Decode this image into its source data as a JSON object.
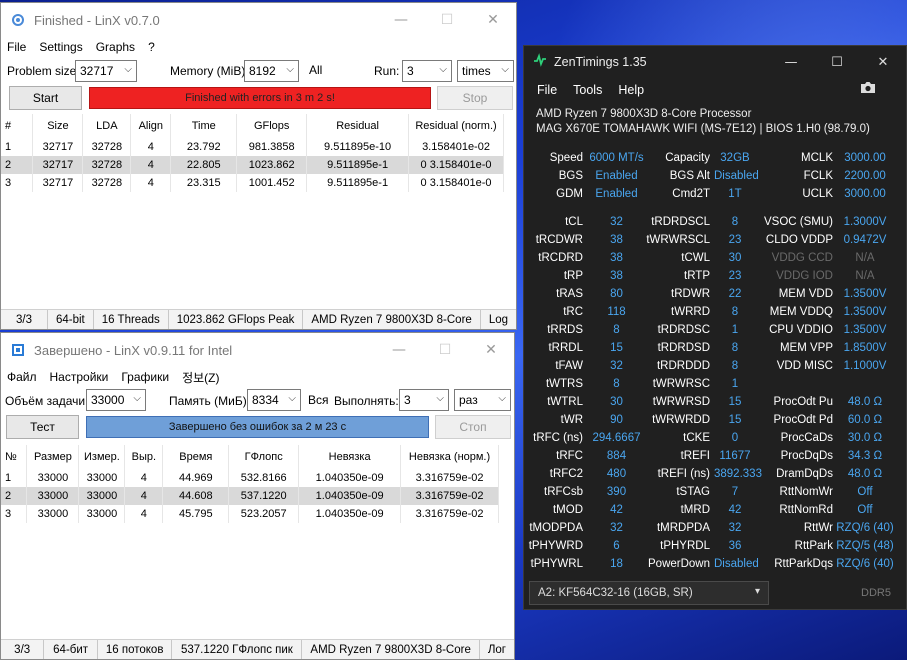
{
  "win1": {
    "title": "Finished - LinX v0.7.0",
    "menu": [
      "File",
      "Settings",
      "Graphs",
      "?"
    ],
    "problem_label": "Problem size:",
    "problem_value": "32717",
    "memory_label": "Memory (MiB):",
    "memory_value": "8192",
    "all_label": "All",
    "run_label": "Run:",
    "run_value": "3",
    "times_value": "times",
    "start": "Start",
    "stop": "Stop",
    "progress": "Finished with errors in 3 m 2 s!",
    "headers": [
      "#",
      "Size",
      "LDA",
      "Align",
      "Time",
      "GFlops",
      "Residual",
      "Residual (norm.)"
    ],
    "rows": [
      [
        "1",
        "32717",
        "32728",
        "4",
        "23.792",
        "981.3858",
        "9.511895e-10",
        "3.158401e-02"
      ],
      [
        "2",
        "32717",
        "32728",
        "4",
        "22.805",
        "1023.862",
        "9.511895e-1",
        "0 3.158401e-0"
      ],
      [
        "3",
        "32717",
        "32728",
        "4",
        "23.315",
        "1001.452",
        "9.511895e-1",
        "0 3.158401e-0"
      ]
    ],
    "status": [
      "3/3",
      "64-bit",
      "16 Threads",
      "1023.862 GFlops Peak",
      "AMD Ryzen 7 9800X3D 8-Core",
      "Log"
    ]
  },
  "win2": {
    "title": "Завершено - LinX v0.9.11 for Intel",
    "menu": [
      "Файл",
      "Настройки",
      "Графики",
      "정보(Z)"
    ],
    "problem_label": "Объём задачи:",
    "problem_value": "33000",
    "memory_label": "Память (МиБ):",
    "memory_value": "8334",
    "all_label": "Вся",
    "run_label": "Выполнять:",
    "run_value": "3",
    "times_value": "раз",
    "start": "Тест",
    "stop": "Стоп",
    "progress": "Завершено без ошибок за 2 м 23 с",
    "headers": [
      "№",
      "Размер",
      "Измер.",
      "Выр.",
      "Время",
      "ГФлопс",
      "Невязка",
      "Невязка (норм.)"
    ],
    "rows": [
      [
        "1",
        "33000",
        "33000",
        "4",
        "44.969",
        "532.8166",
        "1.040350e-09",
        "3.316759e-02"
      ],
      [
        "2",
        "33000",
        "33000",
        "4",
        "44.608",
        "537.1220",
        "1.040350e-09",
        "3.316759e-02"
      ],
      [
        "3",
        "33000",
        "33000",
        "4",
        "45.795",
        "523.2057",
        "1.040350e-09",
        "3.316759e-02"
      ]
    ],
    "status": [
      "3/3",
      "64-бит",
      "16 потоков",
      "537.1220 ГФлопс пик",
      "AMD Ryzen 7 9800X3D 8-Core",
      "Лог"
    ]
  },
  "zen": {
    "title": "ZenTimings 1.35",
    "menu": [
      "File",
      "Tools",
      "Help"
    ],
    "cpu": "AMD Ryzen 7 9800X3D 8-Core Processor",
    "board": "MAG X670E TOMAHAWK WIFI (MS-7E12) | BIOS 1.H0 (98.79.0)",
    "top": [
      [
        "Speed",
        "6000 MT/s",
        "Capacity",
        "32GB",
        "MCLK",
        "3000.00"
      ],
      [
        "BGS",
        "Enabled",
        "BGS Alt",
        "Disabled",
        "FCLK",
        "2200.00"
      ],
      [
        "GDM",
        "Enabled",
        "Cmd2T",
        "1T",
        "UCLK",
        "3000.00"
      ]
    ],
    "timings": [
      [
        "tCL",
        "32",
        "tRDRDSCL",
        "8",
        "VSOC (SMU)",
        "1.3000V"
      ],
      [
        "tRCDWR",
        "38",
        "tWRWRSCL",
        "23",
        "CLDO VDDP",
        "0.9472V"
      ],
      [
        "tRCDRD",
        "38",
        "tCWL",
        "30",
        "VDDG CCD",
        "N/A"
      ],
      [
        "tRP",
        "38",
        "tRTP",
        "23",
        "VDDG IOD",
        "N/A"
      ],
      [
        "tRAS",
        "80",
        "tRDWR",
        "22",
        "MEM VDD",
        "1.3500V"
      ],
      [
        "tRC",
        "118",
        "tWRRD",
        "8",
        "MEM VDDQ",
        "1.3500V"
      ],
      [
        "tRRDS",
        "8",
        "tRDRDSC",
        "1",
        "CPU VDDIO",
        "1.3500V"
      ],
      [
        "tRRDL",
        "15",
        "tRDRDSD",
        "8",
        "MEM VPP",
        "1.8500V"
      ],
      [
        "tFAW",
        "32",
        "tRDRDDD",
        "8",
        "VDD MISC",
        "1.1000V"
      ],
      [
        "tWTRS",
        "8",
        "tWRWRSC",
        "1",
        "",
        ""
      ],
      [
        "tWTRL",
        "30",
        "tWRWRSD",
        "15",
        "ProcOdt Pu",
        "48.0 Ω"
      ],
      [
        "tWR",
        "90",
        "tWRWRDD",
        "15",
        "ProcOdt Pd",
        "60.0 Ω"
      ],
      [
        "tRFC (ns)",
        "294.6667",
        "tCKE",
        "0",
        "ProcCaDs",
        "30.0 Ω"
      ],
      [
        "tRFC",
        "884",
        "tREFI",
        "11677",
        "ProcDqDs",
        "34.3 Ω"
      ],
      [
        "tRFC2",
        "480",
        "tREFI (ns)",
        "3892.333",
        "DramDqDs",
        "48.0 Ω"
      ],
      [
        "tRFCsb",
        "390",
        "tSTAG",
        "7",
        "RttNomWr",
        "Off"
      ],
      [
        "tMOD",
        "42",
        "tMRD",
        "42",
        "RttNomRd",
        "Off"
      ],
      [
        "tMODPDA",
        "32",
        "tMRDPDA",
        "32",
        "RttWr",
        "RZQ/6 (40)"
      ],
      [
        "tPHYWRD",
        "6",
        "tPHYRDL",
        "36",
        "RttPark",
        "RZQ/5 (48)"
      ],
      [
        "tPHYWRL",
        "18",
        "PowerDown",
        "Disabled",
        "RttParkDqs",
        "RZQ/6 (40)"
      ]
    ],
    "dim_keys": [
      "VDDG CCD",
      "VDDG IOD"
    ],
    "module": "A2: KF564C32-16 (16GB, SR)",
    "ddr": "DDR5"
  }
}
